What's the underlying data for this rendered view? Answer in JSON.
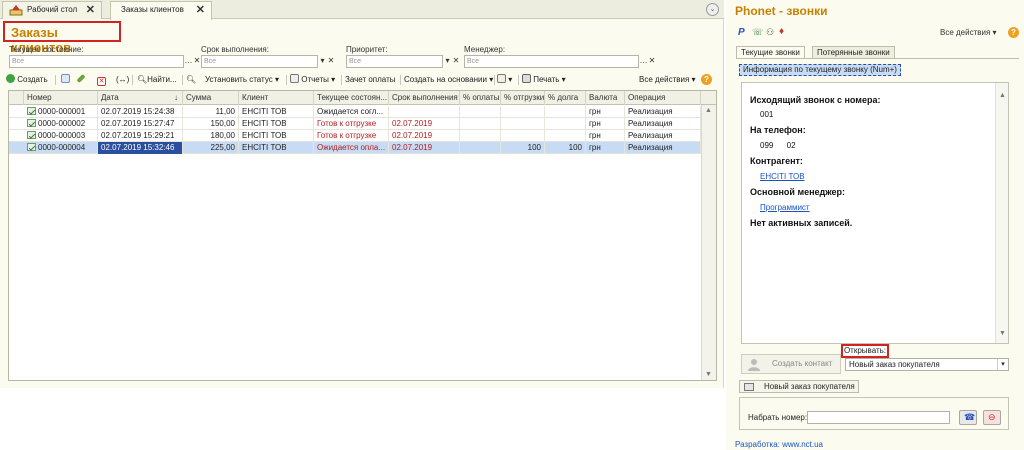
{
  "tabs": [
    {
      "label": "Рабочий стол"
    },
    {
      "label": "Заказы клиентов"
    }
  ],
  "page_title": "Заказы клиентов",
  "filters": {
    "state_label": "Текущее состояние:",
    "state_placeholder": "Все",
    "due_label": "Срок выполнения:",
    "due_placeholder": "Все",
    "priority_label": "Приоритет:",
    "priority_placeholder": "Все",
    "manager_label": "Менеджер:",
    "manager_placeholder": "Все"
  },
  "toolbar": {
    "create": "Создать",
    "find": "Найти...",
    "set_status": "Установить статус",
    "reports": "Отчеты",
    "payment_offset": "Зачет оплаты",
    "create_based": "Создать на основании",
    "print": "Печать",
    "all_actions": "Все действия"
  },
  "table": {
    "headers": [
      "Номер",
      "Дата",
      "Сумма",
      "Клиент",
      "Текущее состоян...",
      "Срок выполнения",
      "% оплаты",
      "% отгрузки",
      "% долга",
      "Валюта",
      "Операция"
    ],
    "rows": [
      {
        "number": "0000-000001",
        "date": "02.07.2019 15:24:38",
        "sum": "11,00",
        "client": "ЕНСІТІ ТОВ",
        "state": "Ожидается согл...",
        "due": "",
        "pay": "",
        "ship": "",
        "debt": "",
        "currency": "грн",
        "operation": "Реализация"
      },
      {
        "number": "0000-000002",
        "date": "02.07.2019 15:27:47",
        "sum": "150,00",
        "client": "ЕНСІТІ ТОВ",
        "state": "Готов к отгрузке",
        "due": "02.07.2019",
        "pay": "",
        "ship": "",
        "debt": "",
        "currency": "грн",
        "operation": "Реализация"
      },
      {
        "number": "0000-000003",
        "date": "02.07.2019 15:29:21",
        "sum": "180,00",
        "client": "ЕНСІТІ ТОВ",
        "state": "Готов к отгрузке",
        "due": "02.07.2019",
        "pay": "",
        "ship": "",
        "debt": "",
        "currency": "грн",
        "operation": "Реализация"
      },
      {
        "number": "0000-000004",
        "date": "02.07.2019 15:32:46",
        "sum": "225,00",
        "client": "ЕНСІТІ ТОВ",
        "state": "Ожидается опла...",
        "due": "02.07.2019",
        "pay": "",
        "ship": "100",
        "debt": "100",
        "currency": "грн",
        "operation": "Реализация"
      }
    ]
  },
  "phonet": {
    "title": "Phonet - звонки",
    "all_actions": "Все действия",
    "tab_current": "Текущие звонки",
    "tab_lost": "Потерянные звонки",
    "info_button": "Информация по текущему звонку (Num+)",
    "outgoing_label": "Исходящий звонок с номера:",
    "outgoing_value": "001",
    "to_phone_label": "На телефон:",
    "to_phone_value": "099      02",
    "contractor_label": "Контрагент:",
    "contractor_value": "ЕНСІТІ ТОВ",
    "manager_label": "Основной менеджер:",
    "manager_value": "Программист",
    "no_records": "Нет активных записей.",
    "open_label": "Открывать:",
    "create_contact": "Создать контакт",
    "order_select": "Новый заказ покупателя",
    "new_order_button": "Новый заказ покупателя",
    "dial_label": "Набрать номер:",
    "dev_link": "Разработка: www.nct.ua"
  },
  "colors": {
    "title": "#c88000",
    "highlight_red": "#d32222",
    "selection": "#c7dcf4",
    "link": "#1a54c4"
  }
}
